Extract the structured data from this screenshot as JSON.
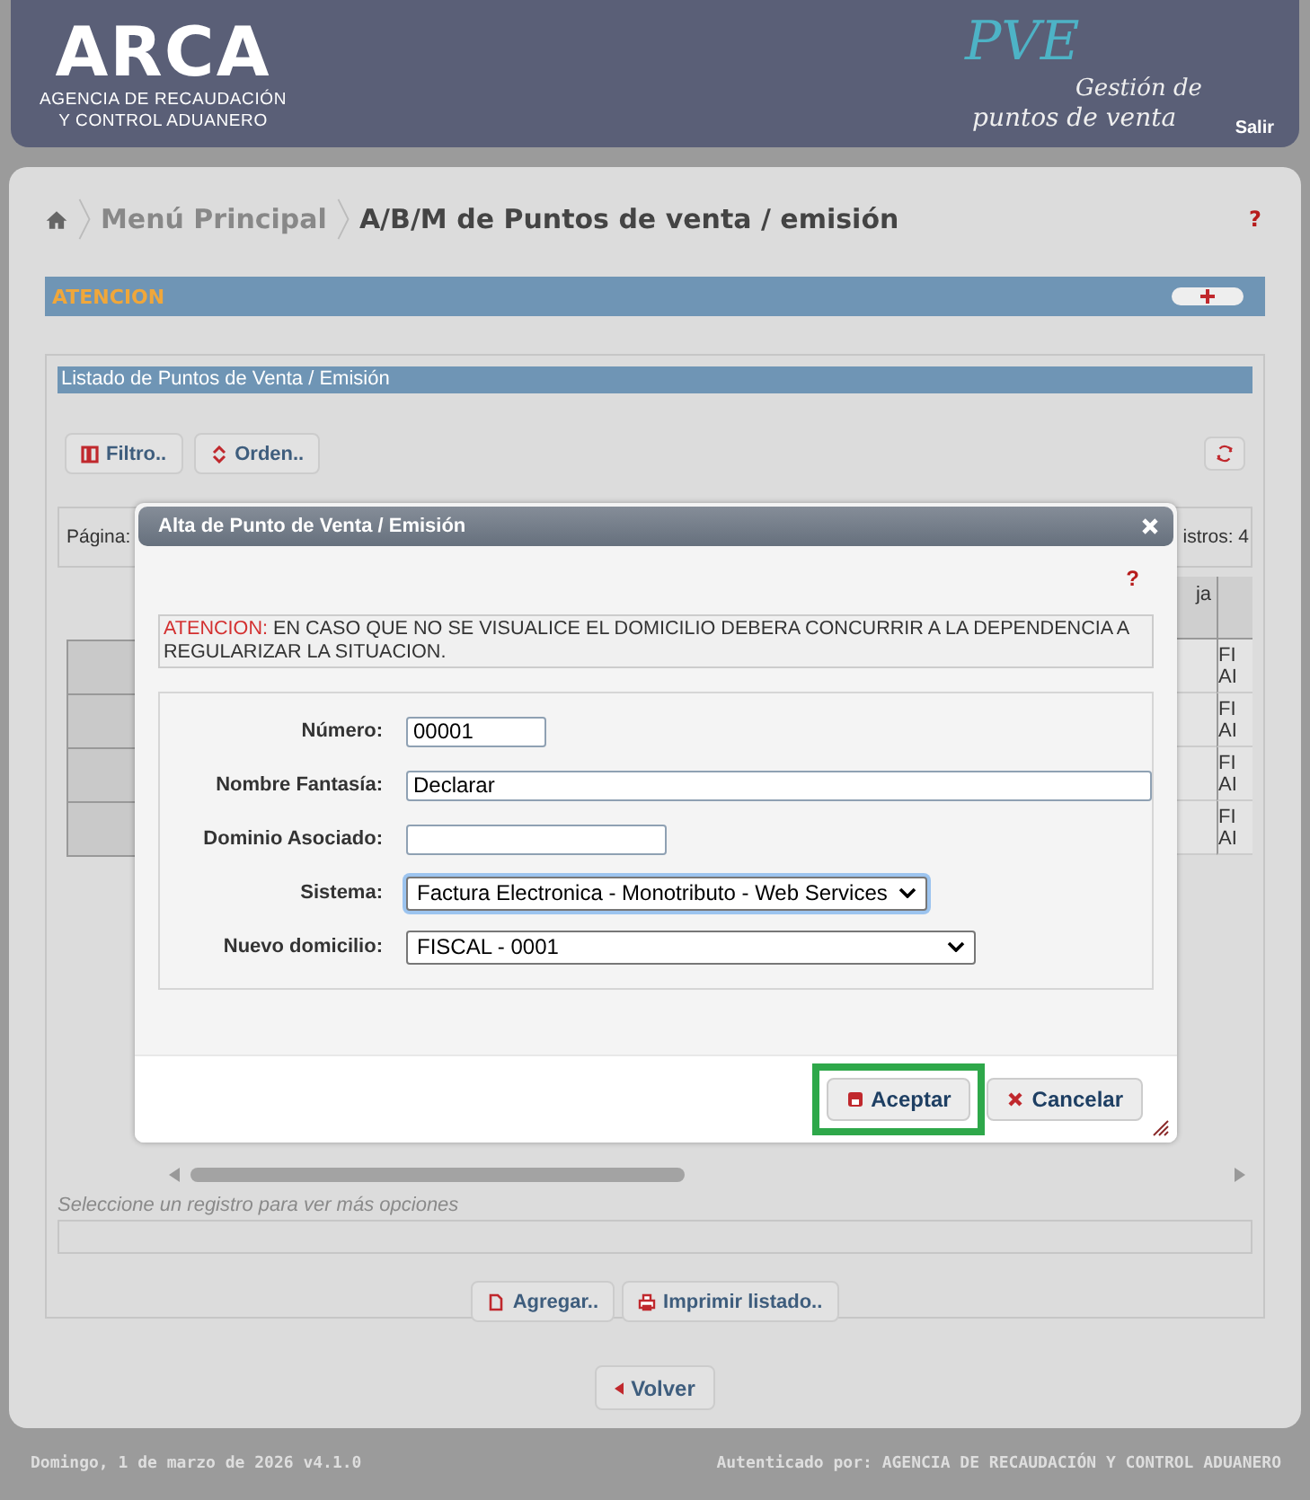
{
  "header": {
    "logo": "ARCA",
    "agency_line1": "AGENCIA DE RECAUDACIÓN",
    "agency_line2": "Y CONTROL ADUANERO",
    "app_name": "PVE",
    "app_subtitle_line1": "Gestión de",
    "app_subtitle_line2": "puntos de venta",
    "logout": "Salir"
  },
  "breadcrumb": [
    {
      "label": "Menú Principal",
      "current": false
    },
    {
      "label": "A/B/M de Puntos de venta / emisión",
      "current": true
    }
  ],
  "help": "?",
  "attention_panel": {
    "title": "ATENCION",
    "expanded": false
  },
  "listing": {
    "title": "Listado de Puntos de Venta / Emisión",
    "toolbar": [
      {
        "label": "Filtro.."
      },
      {
        "label": "Orden.."
      }
    ],
    "pager": {
      "page_label": "Página:",
      "records_label": "istros: 4"
    },
    "table": {
      "header_fragment": "ja",
      "rows": [
        {
          "fragment": [
            "FI",
            "AI"
          ]
        },
        {
          "fragment": [
            "FI",
            "AI"
          ]
        },
        {
          "fragment": [
            "FI",
            "AI"
          ]
        },
        {
          "fragment": [
            "FI",
            "AI"
          ]
        }
      ]
    },
    "hint": "Seleccione un registro para ver más opciones",
    "actions": [
      {
        "label": "Agregar.."
      },
      {
        "label": "Imprimir listado.."
      }
    ]
  },
  "back_button": {
    "label": "Volver"
  },
  "dialog": {
    "title": "Alta de Punto de Venta / Emisión",
    "help": "?",
    "warning": {
      "label": "ATENCION:",
      "text": "EN CASO QUE NO SE VISUALICE EL DOMICILIO DEBERA CONCURRIR A LA DEPENDENCIA A REGULARIZAR LA SITUACION."
    },
    "fields": [
      {
        "label": "Número:",
        "kind": "text",
        "value": "00001",
        "focused": false
      },
      {
        "label": "Nombre Fantasía:",
        "kind": "text",
        "value": "Declarar",
        "focused": false
      },
      {
        "label": "Dominio Asociado:",
        "kind": "text",
        "focused": false
      },
      {
        "label": "Sistema:",
        "kind": "select",
        "value": "Factura Electronica - Monotributo - Web Services",
        "focused": true
      },
      {
        "label": "Nuevo domicilio:",
        "kind": "select",
        "value": "FISCAL - 0001",
        "focused": false
      }
    ],
    "buttons": [
      {
        "label": "Aceptar",
        "highlighted": true
      },
      {
        "label": "Cancelar",
        "highlighted": false
      }
    ]
  },
  "footer": {
    "date": "Domingo, 1 de marzo de 2026 v4.1.0",
    "auth": "Autenticado por: AGENCIA DE RECAUDACIÓN Y CONTROL ADUANERO"
  }
}
